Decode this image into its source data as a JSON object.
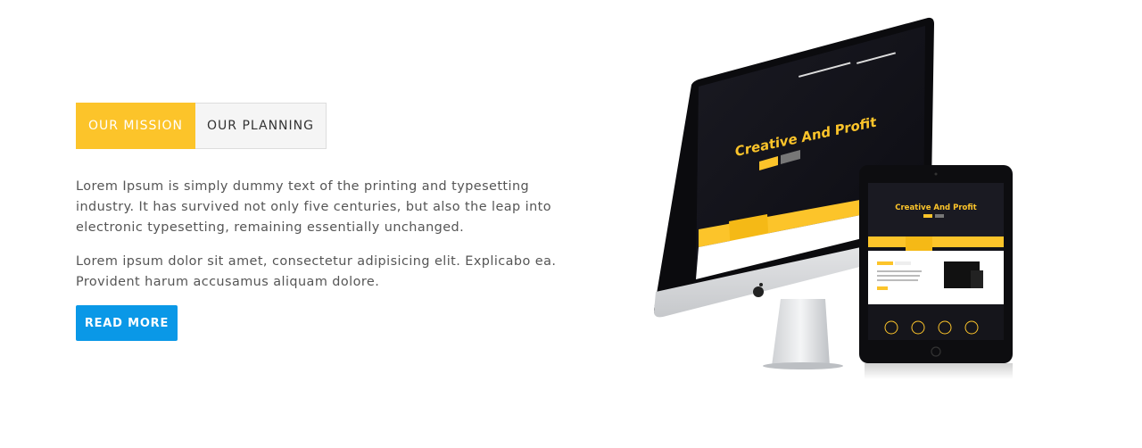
{
  "tabs": [
    {
      "label": "OUR MISSION",
      "active": true
    },
    {
      "label": "OUR PLANNING",
      "active": false
    }
  ],
  "content": {
    "paragraph_1": "Lorem Ipsum is simply dummy text of the printing and typesetting industry. It has survived not only five centuries, but also the leap into electronic typesetting, remaining essentially unchanged.",
    "paragraph_2": "Lorem ipsum dolor sit amet, consectetur adipisicing elit. Explicabo ea. Provident harum accusamus aliquam dolore.",
    "read_more_label": "READ MORE"
  },
  "illustration": {
    "monitor_headline": "Creative And Profit",
    "tablet_headline": "Creative And Profit"
  },
  "colors": {
    "accent_yellow": "#fcc42a",
    "button_blue": "#0a98e7",
    "tab_inactive_bg": "#f5f5f5",
    "body_text": "#555555"
  }
}
